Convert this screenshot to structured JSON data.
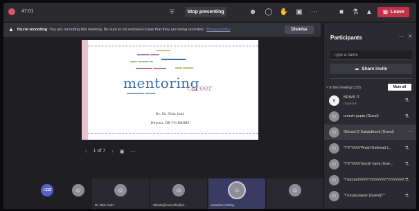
{
  "topbar": {
    "timer": "47:01",
    "stop_presenting_label": "Stop presenting",
    "leave_label": "Leave",
    "recording_color": "#e0556b",
    "leave_color": "#c4314b"
  },
  "banner": {
    "title": "You're recording",
    "message": "You are recording this meeting. Be sure to let everyone know that they are being recorded.",
    "link": "Privacy policy",
    "dismiss_label": "Dismiss"
  },
  "slide": {
    "headline": "mentoring",
    "subword": "career",
    "author": "By: Dr. Nitin Joshi",
    "role": "Director, DR VN BRIMS"
  },
  "pager": {
    "label": "1 of 7"
  },
  "strip": {
    "overflow_count": "+115",
    "tiles": [
      {
        "name": "Dr. Nitin Joshi"
      },
      {
        "name": "Shinde@Anirudha@Vi..."
      },
      {
        "name": "Kanchan Akshay"
      },
      {
        "name": ""
      }
    ]
  },
  "panel": {
    "title": "Participants",
    "search_placeholder": "Type a name",
    "share_invite_label": "Share invite",
    "section_label": "In this meeting (120)",
    "mute_all_label": "Mute all",
    "participants": [
      {
        "name": "BRIMS IT",
        "role": "Organizer",
        "initials": "B"
      },
      {
        "name": "umesh gupta (Guest)",
        "initials": ""
      },
      {
        "name": "Shivani D Katakdhond (Guest)",
        "initials": ""
      },
      {
        "name": "\"\\\"\\\\\\\"\\\\\\\\\\\\\\\\\"Anjali Gaikwad (...",
        "initials": ""
      },
      {
        "name": "\"\\\"\\\\\\\"\\\\\\\\\\\\\\\\\"ayush haria (Gue...",
        "initials": ""
      },
      {
        "name": "\"\\\"purparti\\\\\\\\\\\\\\\\\"\\\\\\\\\\\\\\\\\\\\\\\\\\\\\\\\\"\\\\\\\\\\\\\\\\\\\\\\\\\\\\\\\\\" di...",
        "initials": ""
      },
      {
        "name": "\"\\\"rutuja pawar (Guest)\\\"\"",
        "initials": ""
      }
    ]
  }
}
